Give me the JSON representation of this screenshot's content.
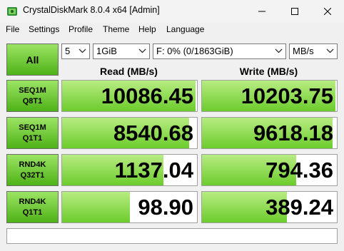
{
  "window": {
    "title": "CrystalDiskMark 8.0.4 x64 [Admin]"
  },
  "menu": [
    "File",
    "Settings",
    "Profile",
    "Theme",
    "Help",
    "Language"
  ],
  "controls": {
    "all_label": "All",
    "count": "5",
    "size": "1GiB",
    "drive": "F: 0% (0/1863GiB)",
    "unit": "MB/s"
  },
  "headers": {
    "read": "Read (MB/s)",
    "write": "Write (MB/s)"
  },
  "tests": [
    {
      "label1": "SEQ1M",
      "label2": "Q8T1",
      "read": "10086.45",
      "write": "10203.75",
      "read_fill": 0.99,
      "write_fill": 0.99
    },
    {
      "label1": "SEQ1M",
      "label2": "Q1T1",
      "read": "8540.68",
      "write": "9618.18",
      "read_fill": 0.94,
      "write_fill": 0.97
    },
    {
      "label1": "RND4K",
      "label2": "Q32T1",
      "read": "1137.04",
      "write": "794.36",
      "read_fill": 0.75,
      "write_fill": 0.7
    },
    {
      "label1": "RND4K",
      "label2": "Q1T1",
      "read": "98.90",
      "write": "389.24",
      "read_fill": 0.5,
      "write_fill": 0.63
    }
  ],
  "comment": "",
  "colors": {
    "green_top": "#9ce464",
    "green_bottom": "#4eb217",
    "bar_light": "#b8ec82",
    "bar_dark": "#6ccc2c"
  }
}
